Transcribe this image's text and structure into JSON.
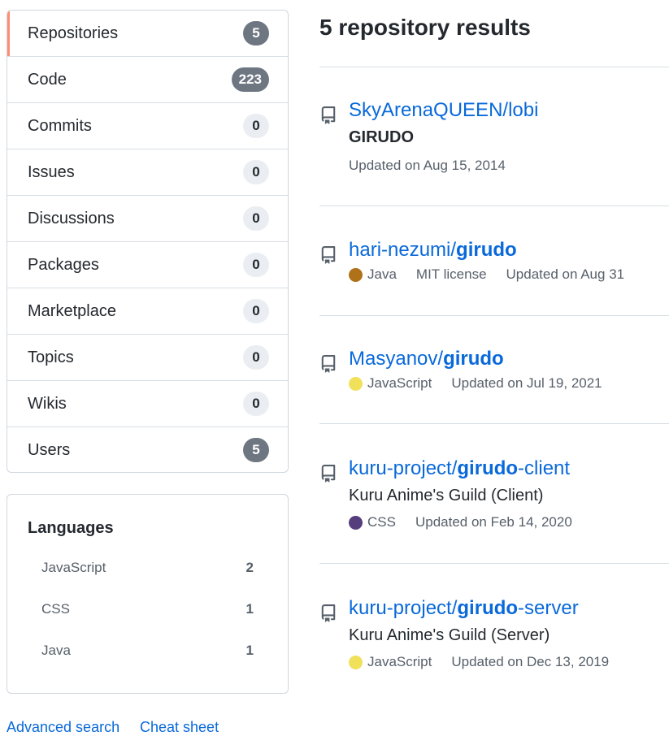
{
  "nav": {
    "items": [
      {
        "label": "Repositories",
        "count": "5",
        "style": "dark",
        "selected": true
      },
      {
        "label": "Code",
        "count": "223",
        "style": "dark",
        "selected": false
      },
      {
        "label": "Commits",
        "count": "0",
        "style": "light",
        "selected": false
      },
      {
        "label": "Issues",
        "count": "0",
        "style": "light",
        "selected": false
      },
      {
        "label": "Discussions",
        "count": "0",
        "style": "light",
        "selected": false
      },
      {
        "label": "Packages",
        "count": "0",
        "style": "light",
        "selected": false
      },
      {
        "label": "Marketplace",
        "count": "0",
        "style": "light",
        "selected": false
      },
      {
        "label": "Topics",
        "count": "0",
        "style": "light",
        "selected": false
      },
      {
        "label": "Wikis",
        "count": "0",
        "style": "light",
        "selected": false
      },
      {
        "label": "Users",
        "count": "5",
        "style": "dark",
        "selected": false
      }
    ]
  },
  "languages": {
    "title": "Languages",
    "items": [
      {
        "name": "JavaScript",
        "count": "2"
      },
      {
        "name": "CSS",
        "count": "1"
      },
      {
        "name": "Java",
        "count": "1"
      }
    ]
  },
  "footer": {
    "advanced": "Advanced search",
    "cheat": "Cheat sheet"
  },
  "results": {
    "title": "5 repository results",
    "repos": [
      {
        "owner": "SkyArenaQUEEN/",
        "name_pre": "lobi",
        "name_hl": "",
        "name_post": "",
        "description": "GIRUDO",
        "description_bold": true,
        "language": "",
        "lang_color": "",
        "license": "",
        "updated": "Updated on Aug 15, 2014"
      },
      {
        "owner": "hari-nezumi/",
        "name_pre": "",
        "name_hl": "girudo",
        "name_post": "",
        "description": "",
        "description_bold": false,
        "language": "Java",
        "lang_color": "#b07219",
        "license": "MIT license",
        "updated": "Updated on Aug 31"
      },
      {
        "owner": "Masyanov/",
        "name_pre": "",
        "name_hl": "girudo",
        "name_post": "",
        "description": "",
        "description_bold": false,
        "language": "JavaScript",
        "lang_color": "#f1e05a",
        "license": "",
        "updated": "Updated on Jul 19, 2021"
      },
      {
        "owner": "kuru-project/",
        "name_pre": "",
        "name_hl": "girudo",
        "name_post": "-client",
        "description": "Kuru Anime's Guild (Client)",
        "description_bold": false,
        "language": "CSS",
        "lang_color": "#563d7c",
        "license": "",
        "updated": "Updated on Feb 14, 2020"
      },
      {
        "owner": "kuru-project/",
        "name_pre": "",
        "name_hl": "girudo",
        "name_post": "-server",
        "description": "Kuru Anime's Guild (Server)",
        "description_bold": false,
        "language": "JavaScript",
        "lang_color": "#f1e05a",
        "license": "",
        "updated": "Updated on Dec 13, 2019"
      }
    ]
  }
}
